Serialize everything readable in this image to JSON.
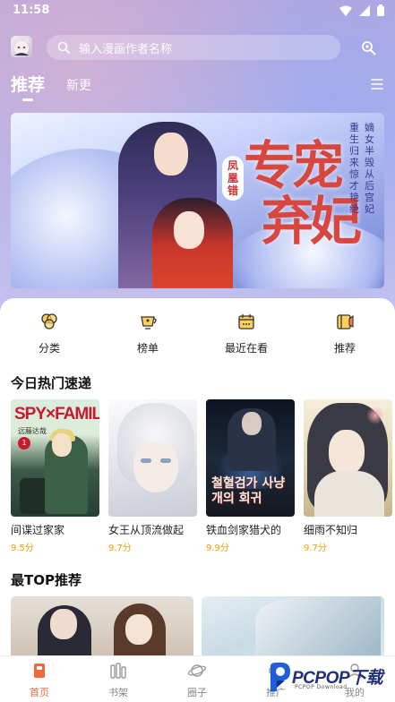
{
  "status_bar": {
    "time": "11:58"
  },
  "header": {
    "search_placeholder": "输入漫画作者名称",
    "tabs": [
      {
        "label": "推荐",
        "active": true
      },
      {
        "label": "新更",
        "active": false
      }
    ]
  },
  "banner": {
    "title_line1": "专宠",
    "title_line2": "弃妃",
    "seal_text": "凤凰错",
    "tagline_col1": "重生归来惊才艳绝",
    "tagline_col2": "嫡女半毁从后宫妃"
  },
  "quick_nav": [
    {
      "label": "分类",
      "icon": "category-icon"
    },
    {
      "label": "榜单",
      "icon": "ranking-icon"
    },
    {
      "label": "最近在看",
      "icon": "recent-icon"
    },
    {
      "label": "推荐",
      "icon": "recommend-icon"
    }
  ],
  "sections": {
    "hot_today": "今日热门速递",
    "top_recommend": "最TOP推荐"
  },
  "hot_manga": [
    {
      "title": "间谍过家家",
      "score": "9.5分",
      "cover_text": "SPY×FAMILY",
      "cover_sub": "远藤达哉",
      "cover_badge": "1"
    },
    {
      "title": "女王从顶流做起",
      "score": "9.7分"
    },
    {
      "title": "铁血剑家猎犬的",
      "score": "9.9分",
      "cover_text": "철혈검가 사냥개의 회귀"
    },
    {
      "title": "细雨不知归",
      "score": "9.7分"
    }
  ],
  "bottom_nav": [
    {
      "label": "首页",
      "icon": "home-icon",
      "active": true
    },
    {
      "label": "书架",
      "icon": "bookshelf-icon",
      "active": false
    },
    {
      "label": "圈子",
      "icon": "planet-icon",
      "active": false
    },
    {
      "label": "推广",
      "icon": "promote-icon",
      "active": false
    },
    {
      "label": "我的",
      "icon": "profile-icon",
      "active": false
    }
  ],
  "watermark": {
    "text": "PCPOP下载",
    "sub": "PCPOP Download"
  },
  "colors": {
    "accent": "#f0683c",
    "score": "#f0a000",
    "brand_blue": "#1f2f7a"
  }
}
